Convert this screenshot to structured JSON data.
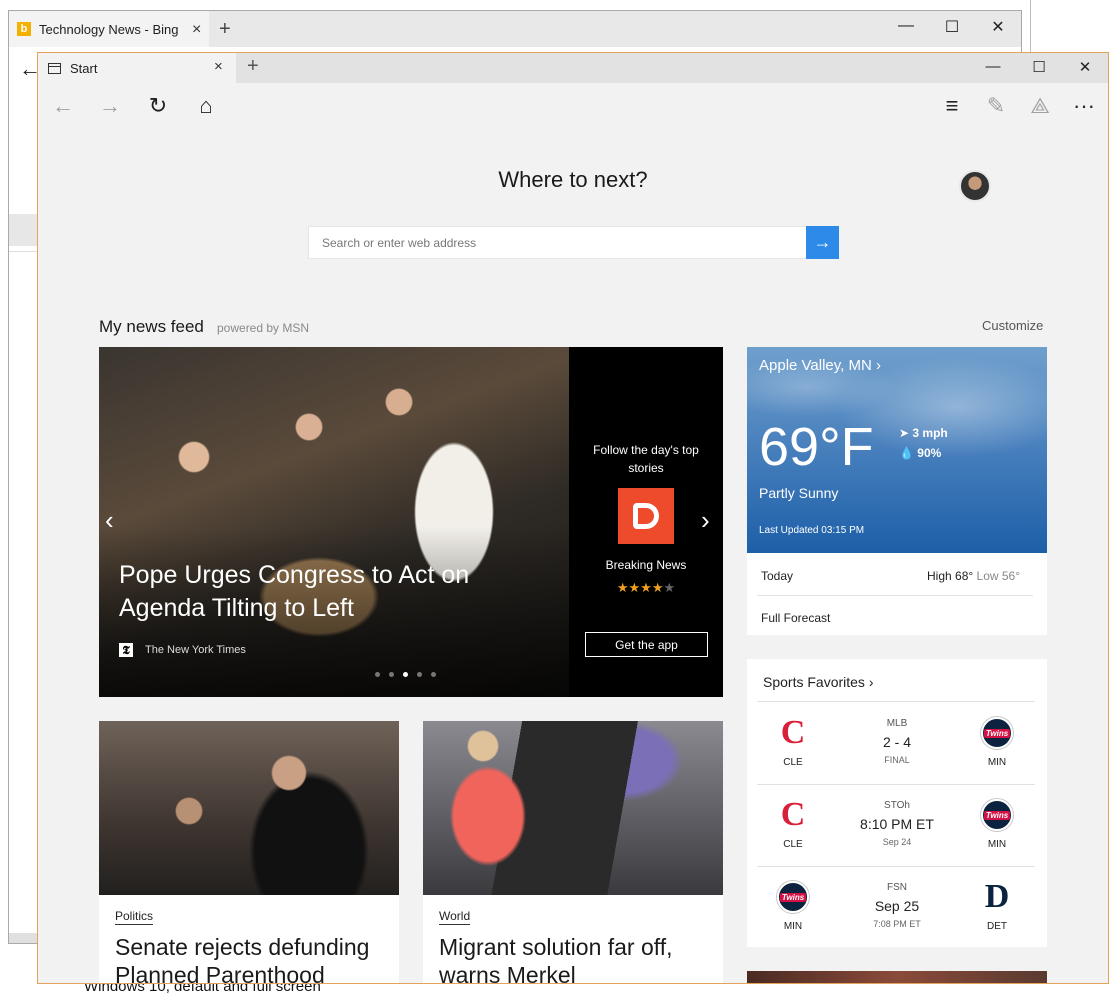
{
  "background_window": {
    "tab_title": "Technology News - Bing",
    "tab_close": "×",
    "new_tab": "+",
    "minimize": "—",
    "maximize": "☐",
    "close": "✕",
    "back": "←"
  },
  "caption": "Windows 10, default and full screen",
  "window": {
    "tab_title": "Start",
    "tab_close": "×",
    "new_tab": "+",
    "minimize": "—",
    "maximize": "☐",
    "close": "✕"
  },
  "toolbar": {
    "back": "←",
    "forward": "→",
    "refresh": "↻",
    "home": "⌂",
    "hub": "≡",
    "note": "✎",
    "share": "⟁",
    "more": "···"
  },
  "start": {
    "heading": "Where to next?",
    "search_placeholder": "Search or enter web address",
    "search_go": "→"
  },
  "feed": {
    "title": "My news feed",
    "powered_by": "powered by MSN",
    "customize": "Customize"
  },
  "hero": {
    "headline": "Pope Urges Congress to Act on Agenda Tilting to Left",
    "source": "The New York Times",
    "source_logo": "𝕿",
    "prev": "‹",
    "next": "›",
    "active_dot": 3,
    "dot_count": 5,
    "promo_text": "Follow the day's top stories",
    "promo_app_name": "Breaking News",
    "promo_rating": 3.5,
    "promo_button": "Get the app"
  },
  "cards": [
    {
      "category": "Politics",
      "title": "Senate rejects defunding Planned Parenthood"
    },
    {
      "category": "World",
      "title": "Migrant solution far off, warns Merkel"
    }
  ],
  "weather": {
    "location": "Apple Valley, MN ›",
    "temperature": "69°F",
    "wind": "3 mph",
    "humidity": "90%",
    "condition": "Partly Sunny",
    "updated": "Last Updated 03:15 PM",
    "today_label": "Today",
    "high": "High 68°",
    "low": "Low 56°",
    "forecast_link": "Full Forecast"
  },
  "sports": {
    "title": "Sports Favorites ›",
    "games": [
      {
        "home": "CLE",
        "away": "MIN",
        "league": "MLB",
        "score": "2 - 4",
        "sub": "FINAL"
      },
      {
        "home": "CLE",
        "away": "MIN",
        "league": "STOh",
        "score": "8:10 PM ET",
        "sub": "Sep 24"
      },
      {
        "home": "MIN",
        "away": "DET",
        "league": "FSN",
        "score": "Sep 25",
        "sub": "7:08 PM ET"
      }
    ]
  },
  "colors": {
    "accent": "#2d8ae8",
    "window_border": "#e3a35a",
    "cle_red": "#d8203a",
    "min_navy": "#0c2340"
  }
}
